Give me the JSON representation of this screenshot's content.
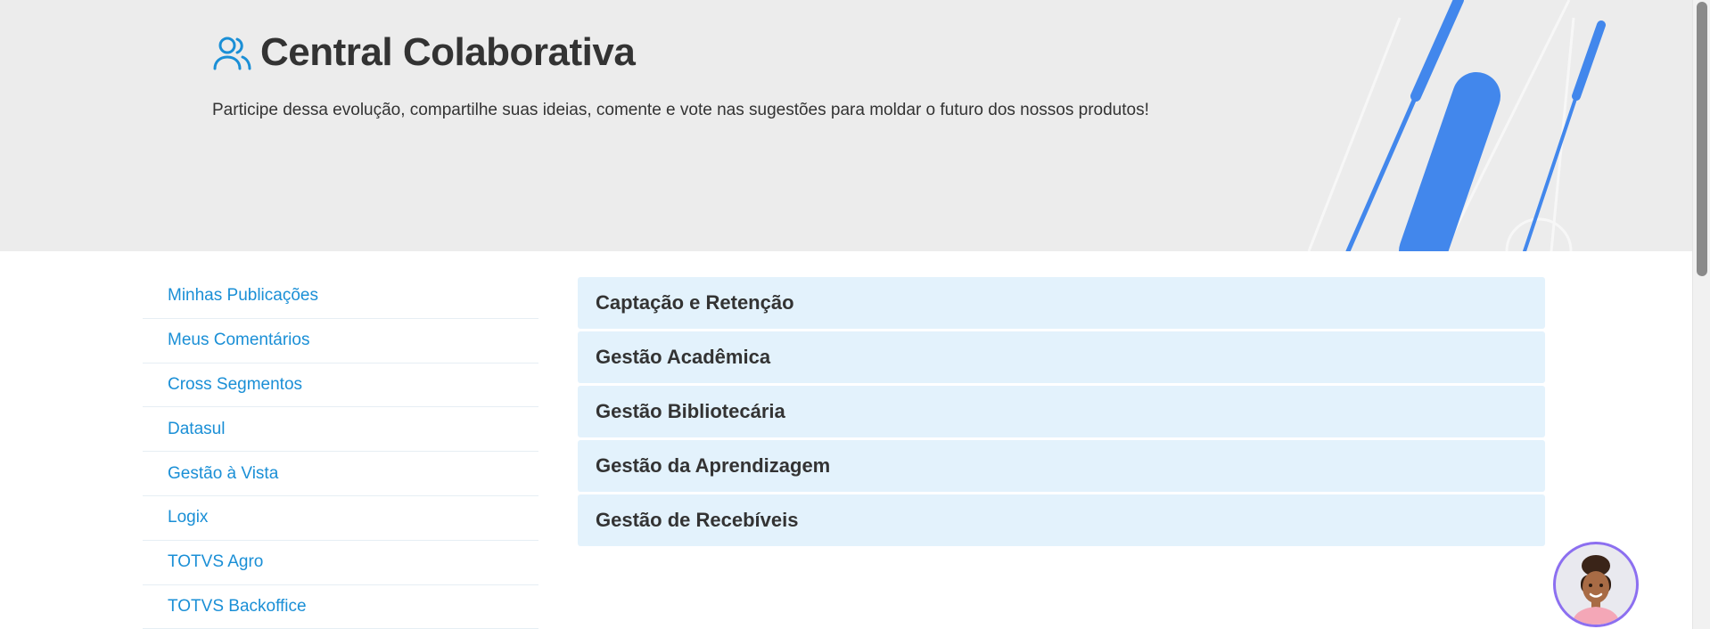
{
  "hero": {
    "title": "Central Colaborativa",
    "subtitle": "Participe dessa evolução, compartilhe suas ideias, comente e vote nas sugestões para moldar o futuro dos nossos produtos!",
    "icon": "users-icon"
  },
  "sidebar": {
    "items": [
      {
        "label": "Minhas Publicações"
      },
      {
        "label": "Meus Comentários"
      },
      {
        "label": "Cross Segmentos"
      },
      {
        "label": "Datasul"
      },
      {
        "label": "Gestão à Vista"
      },
      {
        "label": "Logix"
      },
      {
        "label": "TOTVS Agro"
      },
      {
        "label": "TOTVS Backoffice"
      }
    ]
  },
  "categories": {
    "items": [
      {
        "label": "Captação e Retenção"
      },
      {
        "label": "Gestão Acadêmica"
      },
      {
        "label": "Gestão Bibliotecária"
      },
      {
        "label": "Gestão da Aprendizagem"
      },
      {
        "label": "Gestão de Recebíveis"
      }
    ]
  },
  "colors": {
    "accent": "#1a8fd6",
    "hero_bg": "#ececec",
    "category_bg": "#e3f2fc",
    "decor_blue": "#4287ec",
    "avatar_ring": "#8c6ff0"
  },
  "assistant": {
    "icon": "assistant-avatar-icon"
  }
}
